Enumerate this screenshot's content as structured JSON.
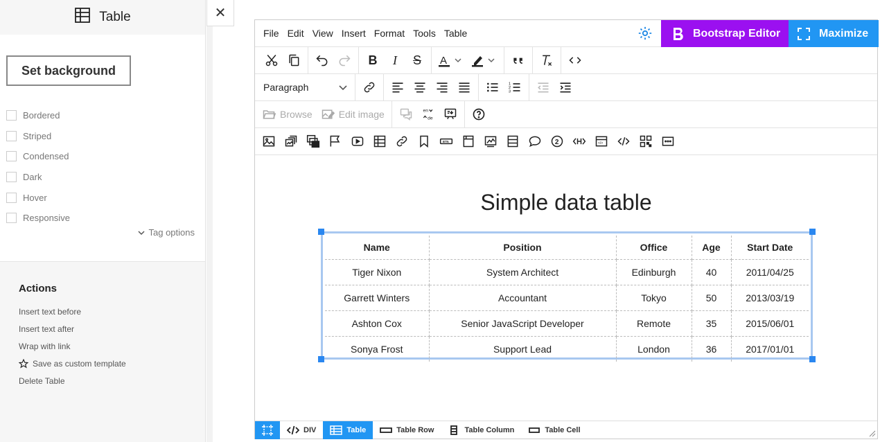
{
  "panel": {
    "title": "Table",
    "set_background": "Set background",
    "options": [
      "Bordered",
      "Striped",
      "Condensed",
      "Dark",
      "Hover",
      "Responsive"
    ],
    "tag_options": "Tag options",
    "actions_title": "Actions",
    "actions": [
      "Insert text before",
      "Insert text after",
      "Wrap with link",
      "Save as custom template",
      "Delete Table"
    ]
  },
  "close": "✕",
  "menubar": {
    "items": [
      "File",
      "Edit",
      "View",
      "Insert",
      "Format",
      "Tools",
      "Table"
    ],
    "bootstrap_editor": "Bootstrap Editor",
    "maximize": "Maximize",
    "accent_purple": "#9b10f0",
    "accent_blue": "#2196f3"
  },
  "toolbar": {
    "block_format": "Paragraph",
    "browse": "Browse",
    "edit_image": "Edit image",
    "lang_top": "en",
    "lang_bottom": "de"
  },
  "document": {
    "title": "Simple data table",
    "headers": [
      "Name",
      "Position",
      "Office",
      "Age",
      "Start Date"
    ],
    "rows": [
      [
        "Tiger Nixon",
        "System Architect",
        "Edinburgh",
        "40",
        "2011/04/25"
      ],
      [
        "Garrett Winters",
        "Accountant",
        "Tokyo",
        "50",
        "2013/03/19"
      ],
      [
        "Ashton Cox",
        "Senior JavaScript Developer",
        "Remote",
        "35",
        "2015/06/01"
      ],
      [
        "Sonya Frost",
        "Support Lead",
        "London",
        "36",
        "2017/01/01"
      ]
    ]
  },
  "statusbar": {
    "items": [
      "DIV",
      "Table",
      "Table Row",
      "Table Column",
      "Table Cell"
    ]
  }
}
